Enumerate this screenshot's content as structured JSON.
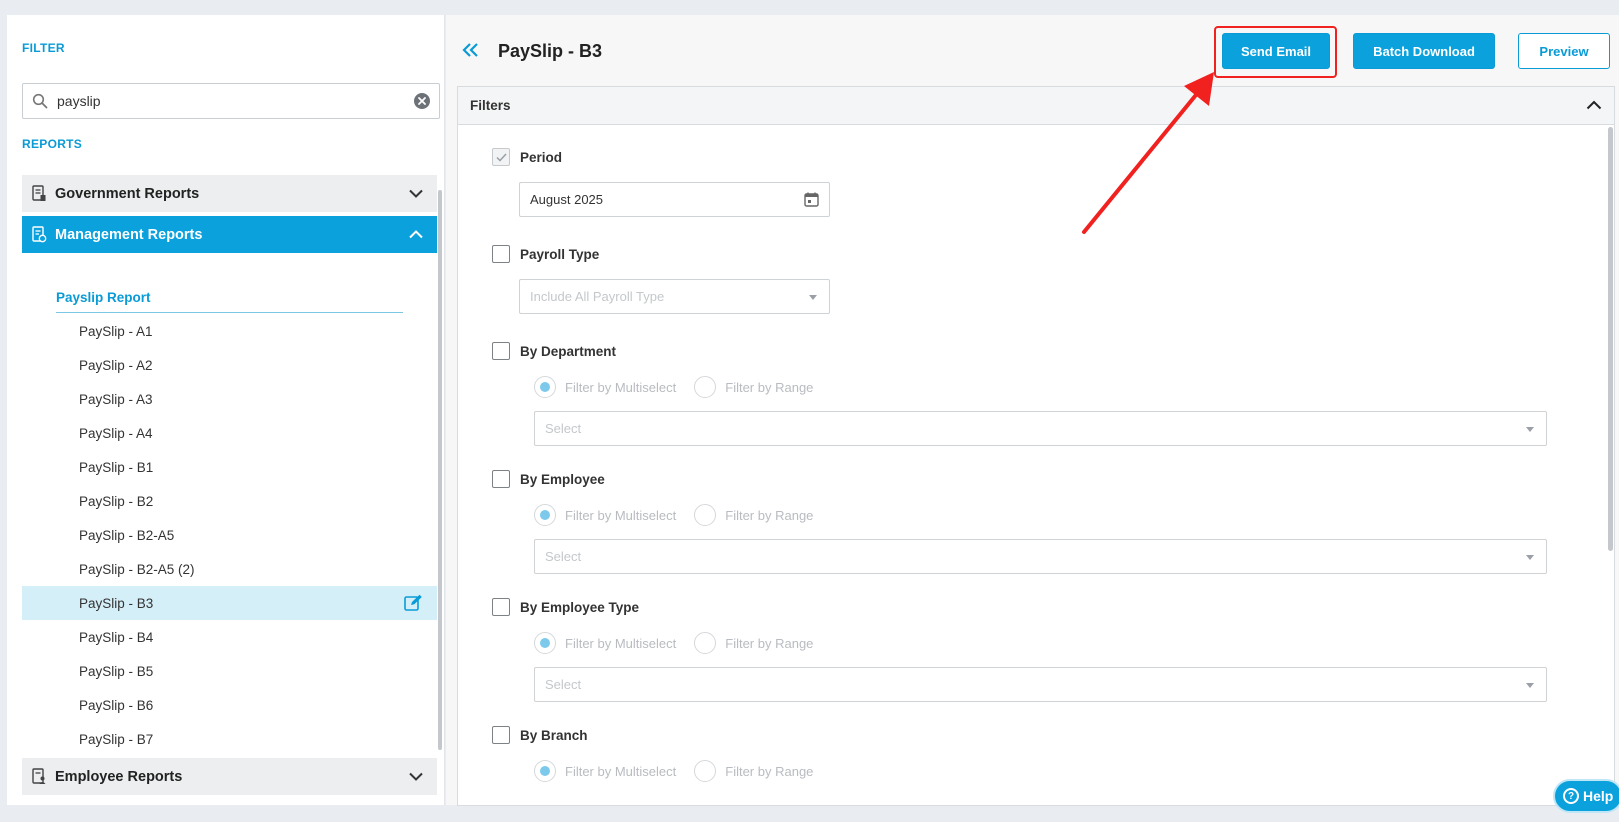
{
  "sidebar": {
    "filter_label": "FILTER",
    "search": {
      "value": "payslip",
      "placeholder": ""
    },
    "reports_label": "REPORTS",
    "groups": {
      "government": {
        "label": "Government Reports",
        "icon": "report-doc-icon",
        "state": "collapsed"
      },
      "management": {
        "label": "Management Reports",
        "icon": "report-settings-icon",
        "state": "expanded"
      },
      "employee": {
        "label": "Employee Reports",
        "icon": "report-people-icon",
        "state": "collapsed"
      }
    },
    "subheading": "Payslip Report",
    "items": [
      {
        "label": "PaySlip - A1"
      },
      {
        "label": "PaySlip - A2"
      },
      {
        "label": "PaySlip - A3"
      },
      {
        "label": "PaySlip - A4"
      },
      {
        "label": "PaySlip - B1"
      },
      {
        "label": "PaySlip - B2"
      },
      {
        "label": "PaySlip - B2-A5"
      },
      {
        "label": "PaySlip - B2-A5 (2)"
      },
      {
        "label": "PaySlip - B3",
        "selected": true
      },
      {
        "label": "PaySlip - B4"
      },
      {
        "label": "PaySlip - B5"
      },
      {
        "label": "PaySlip - B6"
      },
      {
        "label": "PaySlip - B7"
      }
    ]
  },
  "header": {
    "title": "PaySlip - B3",
    "buttons": {
      "send_email": "Send Email",
      "batch_download": "Batch Download",
      "preview": "Preview"
    }
  },
  "filters": {
    "title": "Filters",
    "period": {
      "label": "Period",
      "checked": true,
      "value": "August 2025"
    },
    "payroll_type": {
      "label": "Payroll Type",
      "checked": false,
      "placeholder": "Include All Payroll Type"
    },
    "department": {
      "label": "By Department",
      "checked": false,
      "radio_multi": "Filter by Multiselect",
      "radio_range": "Filter by Range",
      "select_placeholder": "Select"
    },
    "employee": {
      "label": "By Employee",
      "checked": false,
      "radio_multi": "Filter by Multiselect",
      "radio_range": "Filter by Range",
      "select_placeholder": "Select"
    },
    "employee_type": {
      "label": "By Employee Type",
      "checked": false,
      "radio_multi": "Filter by Multiselect",
      "radio_range": "Filter by Range",
      "select_placeholder": "Select"
    },
    "branch": {
      "label": "By Branch",
      "checked": false,
      "radio_multi": "Filter by Multiselect",
      "radio_range": "Filter by Range"
    }
  },
  "help": {
    "label": "Help"
  },
  "colors": {
    "accent": "#0aa1dd",
    "annotation_red": "#f0211f",
    "selected_row": "#d5eff9"
  }
}
